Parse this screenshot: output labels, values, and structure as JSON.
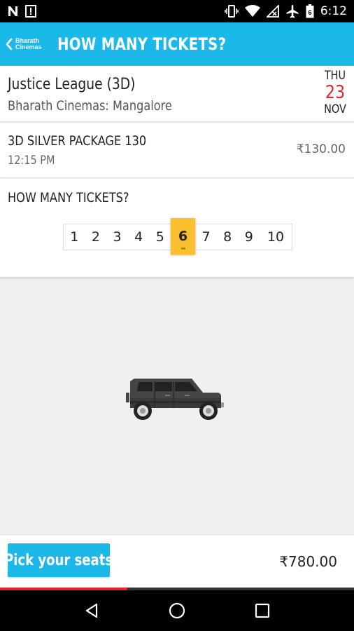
{
  "status_bar": {
    "time": "6:12",
    "battery_level": "6",
    "icons": [
      "n-icon",
      "notification-icon",
      "vibrate-icon",
      "wifi-icon",
      "no-signal-icon",
      "airplane-icon",
      "battery-icon"
    ]
  },
  "app_bar": {
    "brand_line1": "Bharath",
    "brand_line2": "Cinemas",
    "title": "HOW MANY TICKETS?",
    "background": "#1bb9ea"
  },
  "movie": {
    "title": "Justice League (3D)",
    "cinema": "Bharath Cinemas: Mangalore",
    "date": {
      "dow": "THU",
      "day": "23",
      "month": "NOV"
    }
  },
  "package": {
    "name": "3D SILVER PACKAGE 130",
    "time": "12:15 PM",
    "price": "₹130.00"
  },
  "tickets": {
    "heading": "HOW MANY TICKETS?",
    "options": [
      "1",
      "2",
      "3",
      "4",
      "5",
      "6",
      "7",
      "8",
      "9",
      "10"
    ],
    "selected": "6",
    "selected_color": "#fbc02d"
  },
  "footer": {
    "pick_label": "Pick your seats",
    "total": "₹780.00",
    "progress": 0.36,
    "progress_color": "#e3262b"
  },
  "nav": {
    "icons": [
      "back-icon",
      "home-icon",
      "recents-icon"
    ]
  }
}
